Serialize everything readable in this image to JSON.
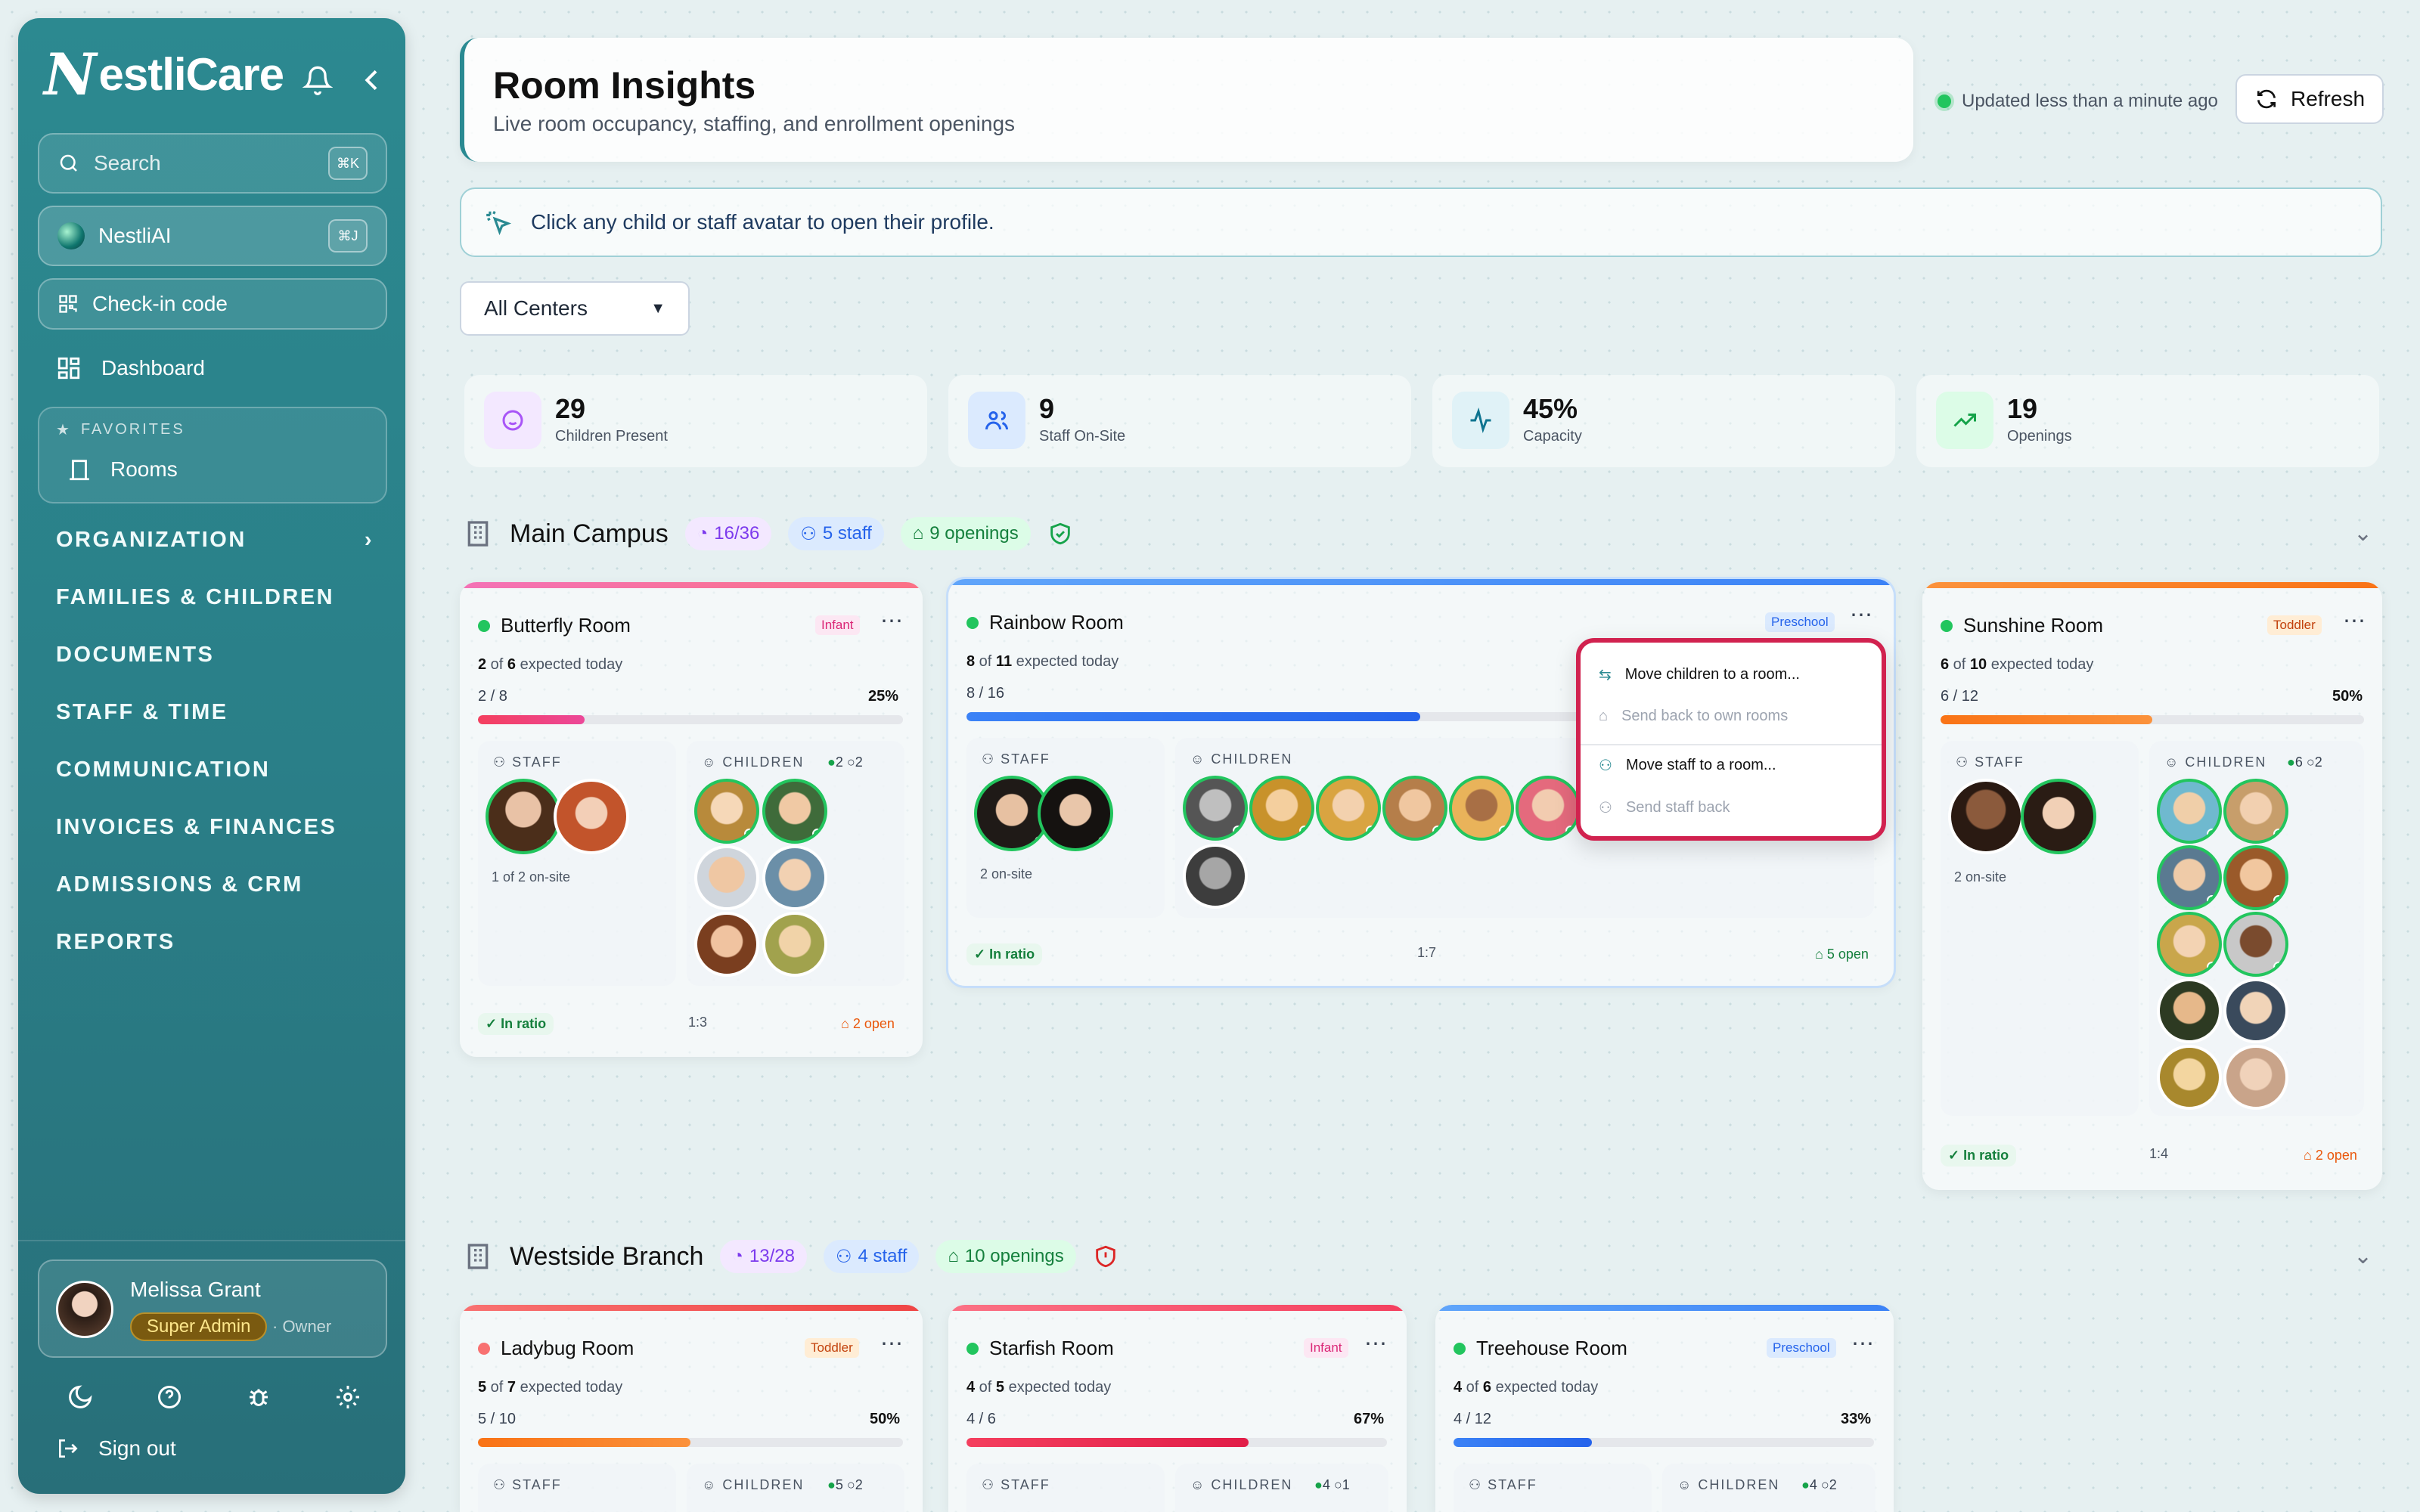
{
  "sidebar": {
    "brand": "NestliCare",
    "brand_first": "N",
    "brand_rest": "estliCare",
    "search": {
      "placeholder": "Search",
      "shortcut": "⌘K"
    },
    "ai": {
      "label": "NestliAI",
      "shortcut": "⌘J"
    },
    "checkin": "Check-in code",
    "dashboard": "Dashboard",
    "favorites": {
      "heading": "FAVORITES",
      "items": [
        "Rooms"
      ]
    },
    "nav": [
      "ORGANIZATION",
      "FAMILIES & CHILDREN",
      "DOCUMENTS",
      "STAFF & TIME",
      "COMMUNICATION",
      "INVOICES & FINANCES",
      "ADMISSIONS & CRM",
      "REPORTS"
    ],
    "user": {
      "name": "Melissa Grant",
      "role": "Super Admin",
      "sub": "· Owner"
    },
    "signout": "Sign out"
  },
  "header": {
    "title": "Room Insights",
    "subtitle": "Live room occupancy, staffing, and enrollment openings",
    "updated": "Updated less than a minute ago",
    "refresh": "Refresh"
  },
  "tip": "Click any child or staff avatar to open their profile.",
  "filter": {
    "selected": "All Centers"
  },
  "stats": [
    {
      "value": "29",
      "label": "Children Present"
    },
    {
      "value": "9",
      "label": "Staff On-Site"
    },
    {
      "value": "45%",
      "label": "Capacity"
    },
    {
      "value": "19",
      "label": "Openings"
    }
  ],
  "sections": [
    {
      "name": "Main Campus",
      "occupancy": "16/36",
      "staff": "5 staff",
      "openings": "9 openings"
    },
    {
      "name": "Westside Branch",
      "occupancy": "13/28",
      "staff": "4 staff",
      "openings": "10 openings"
    }
  ],
  "rooms": {
    "butterfly": {
      "name": "Butterfly Room",
      "tag": "Infant",
      "present": "2",
      "expected": "6",
      "exp_text": "expected today",
      "ratio": "2 / 8",
      "pct": "25%",
      "fill": 0.25,
      "staff_h": "STAFF",
      "children_h": "CHILDREN",
      "in": "2",
      "out": "2",
      "onsite": "1 of 2 on-site",
      "status": "In ratio",
      "ratio_label": "1:3",
      "open": "2 open"
    },
    "rainbow": {
      "name": "Rainbow Room",
      "tag": "Preschool",
      "present": "8",
      "expected": "11",
      "exp_text": "expected today",
      "ratio": "8 / 16",
      "fill": 0.5,
      "staff_h": "STAFF",
      "children_h": "CHILDREN",
      "onsite": "2 on-site",
      "status": "In ratio",
      "ratio_label": "1:7",
      "open": "5 open"
    },
    "sunshine": {
      "name": "Sunshine Room",
      "tag": "Toddler",
      "present": "6",
      "expected": "10",
      "exp_text": "expected today",
      "ratio": "6 / 12",
      "pct": "50%",
      "fill": 0.5,
      "staff_h": "STAFF",
      "children_h": "CHILDREN",
      "in": "6",
      "out": "2",
      "onsite": "2 on-site",
      "status": "In ratio",
      "ratio_label": "1:4",
      "open": "2 open"
    },
    "ladybug": {
      "name": "Ladybug Room",
      "tag": "Toddler",
      "present": "5",
      "expected": "7",
      "exp_text": "expected today",
      "ratio": "5 / 10",
      "pct": "50%",
      "fill": 0.5,
      "staff_h": "STAFF",
      "children_h": "CHILDREN",
      "in": "5",
      "out": "2"
    },
    "starfish": {
      "name": "Starfish Room",
      "tag": "Infant",
      "present": "4",
      "expected": "5",
      "exp_text": "expected today",
      "ratio": "4 / 6",
      "pct": "67%",
      "fill": 0.67,
      "staff_h": "STAFF",
      "children_h": "CHILDREN",
      "in": "4",
      "out": "1"
    },
    "treehouse": {
      "name": "Treehouse Room",
      "tag": "Preschool",
      "present": "4",
      "expected": "6",
      "exp_text": "expected today",
      "ratio": "4 / 12",
      "pct": "33%",
      "fill": 0.33,
      "staff_h": "STAFF",
      "children_h": "CHILDREN",
      "in": "4",
      "out": "2"
    }
  },
  "menu": {
    "items": [
      "Move children to a room...",
      "Send back to own rooms",
      "Move staff to a room...",
      "Send staff back"
    ]
  },
  "colors": {
    "accent": "#2a8a92",
    "green": "#22c55e",
    "highlight": "#d1224f"
  }
}
